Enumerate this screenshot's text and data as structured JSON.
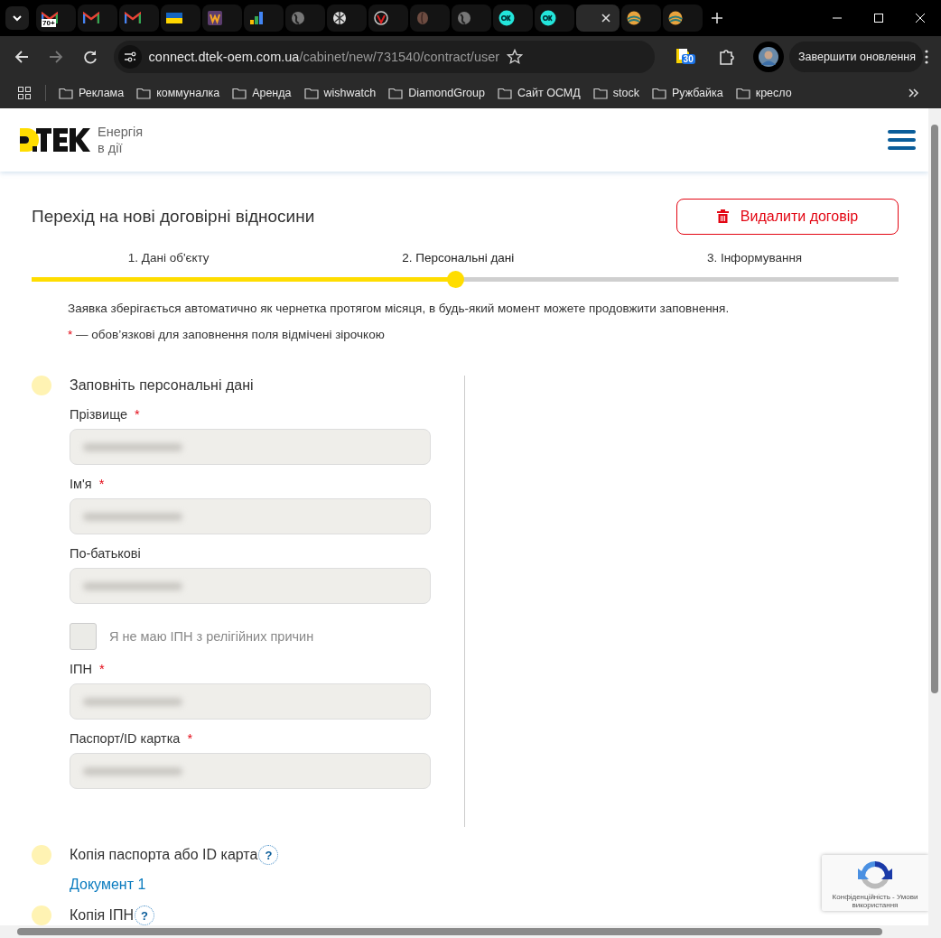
{
  "browser": {
    "tabs": [
      {
        "badge": "70+",
        "selected": false
      },
      {
        "selected": false
      },
      {
        "selected": false
      },
      {
        "selected": false
      },
      {
        "selected": false
      },
      {
        "selected": false
      },
      {
        "selected": false
      },
      {
        "selected": false
      },
      {
        "selected": false
      },
      {
        "selected": false
      },
      {
        "selected": false
      },
      {
        "selected": false
      },
      {
        "selected": false
      },
      {
        "selected": true
      },
      {
        "selected": false
      },
      {
        "selected": false
      }
    ],
    "url_host": "connect.dtek-oem.com.ua",
    "url_path": "/cabinet/new/731540/contract/user",
    "extension_badge": "30",
    "update_button": "Завершити оновлення",
    "bookmarks": [
      "Реклама",
      "коммуналка",
      "Аренда",
      "wishwatch",
      "DiamondGroup",
      "Сайт ОСМД",
      "stock",
      "Ружбайка",
      "кресло"
    ]
  },
  "header": {
    "tagline_1": "Енергія",
    "tagline_2": "в дії"
  },
  "page": {
    "title": "Перехід на нові договірні відносини",
    "delete_button": "Видалити договір",
    "steps": [
      {
        "label": "1. Дані об'єкту",
        "selected": false
      },
      {
        "label": "2. Персональні дані",
        "selected": true
      },
      {
        "label": "3. Інформування",
        "selected": false
      }
    ],
    "progress": {
      "level": 0.49
    },
    "info": "Заявка зберігається автоматично як чернетка протягом місяця, в будь-який момент можете продовжити заповнення.",
    "required_mark": "*",
    "required_note": "— обов’язкові для заповнення поля відмічені зірочкою",
    "sections": [
      {
        "kind": "form",
        "title": "Заповніть персональні дані",
        "items": [
          {
            "kind": "field",
            "label": "Прізвище",
            "required": true
          },
          {
            "kind": "field",
            "label": "Ім'я",
            "required": true
          },
          {
            "kind": "field",
            "label": "По-батькові",
            "required": false
          },
          {
            "kind": "checkbox",
            "label": "Я не маю ІПН з релігійних причин",
            "checked": false,
            "disabled": true
          },
          {
            "kind": "field",
            "label": "ІПН",
            "required": true
          },
          {
            "kind": "field",
            "label": "Паспорт/ID картка",
            "required": true
          }
        ]
      },
      {
        "kind": "upload",
        "title": "Копія паспорта або ID карта",
        "help": "?",
        "link": "Документ 1"
      },
      {
        "kind": "upload",
        "title": "Копія ІПН",
        "help": "?"
      }
    ]
  },
  "recaptcha": {
    "text": "Конфіденційність - Умови використання"
  }
}
